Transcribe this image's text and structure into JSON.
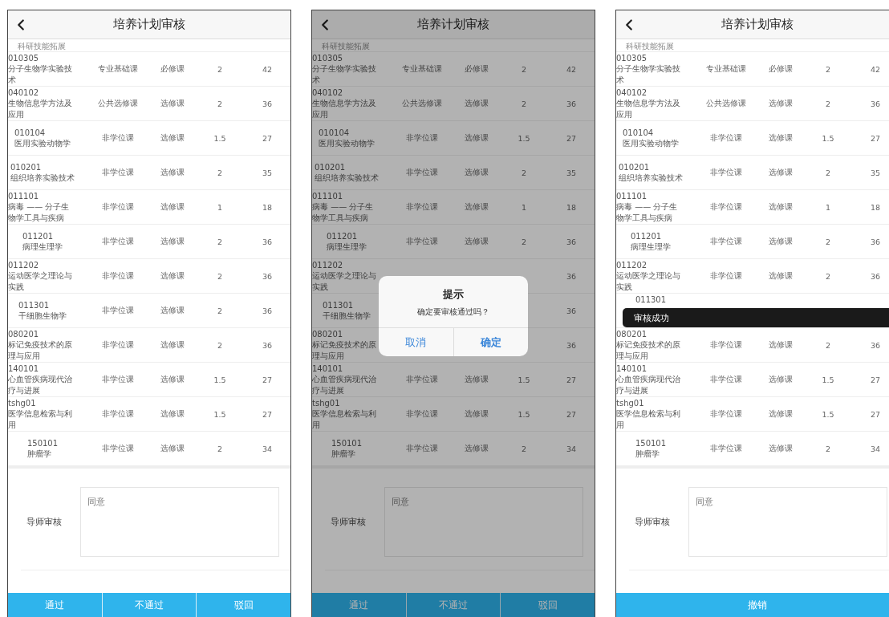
{
  "screens": [
    {
      "title": "培养计划审核",
      "top_note": "科研技能拓展",
      "dimmed": false,
      "rows": [
        {
          "code": "010305",
          "name": "分子生物学实验技术",
          "type": "专业基础课",
          "category": "必修课",
          "credits": "2",
          "hours": "42"
        },
        {
          "code": "040102",
          "name": "生物信息学方法及应用",
          "type": "公共选修课",
          "category": "选修课",
          "credits": "2",
          "hours": "36"
        },
        {
          "code": "010104",
          "name": "医用实验动物学",
          "type": "非学位课",
          "category": "选修课",
          "credits": "1.5",
          "hours": "27"
        },
        {
          "code": "010201",
          "name": "组织培养实验技术",
          "type": "非学位课",
          "category": "选修课",
          "credits": "2",
          "hours": "35"
        },
        {
          "code": "011101",
          "name": "病毒 —— 分子生物学工具与疾病",
          "type": "非学位课",
          "category": "选修课",
          "credits": "1",
          "hours": "18"
        },
        {
          "code": "011201",
          "name": "病理生理学",
          "type": "非学位课",
          "category": "选修课",
          "credits": "2",
          "hours": "36"
        },
        {
          "code": "011202",
          "name": "运动医学之理论与实践",
          "type": "非学位课",
          "category": "选修课",
          "credits": "2",
          "hours": "36"
        },
        {
          "code": "011301",
          "name": "干细胞生物学",
          "type": "非学位课",
          "category": "选修课",
          "credits": "2",
          "hours": "36"
        },
        {
          "code": "080201",
          "name": "标记免疫技术的原理与应用",
          "type": "非学位课",
          "category": "选修课",
          "credits": "2",
          "hours": "36"
        },
        {
          "code": "140101",
          "name": "心血管疾病现代治疗与进展",
          "type": "非学位课",
          "category": "选修课",
          "credits": "1.5",
          "hours": "27"
        },
        {
          "code": "tshg01",
          "name": "医学信息检索与利用",
          "type": "非学位课",
          "category": "选修课",
          "credits": "1.5",
          "hours": "27"
        },
        {
          "code": "150101",
          "name": "肿瘤学",
          "type": "非学位课",
          "category": "选修课",
          "credits": "2",
          "hours": "34"
        }
      ],
      "review": {
        "label": "导师审核",
        "value": "同意"
      },
      "actions": [
        "通过",
        "不通过",
        "驳回"
      ]
    },
    {
      "title": "培养计划审核",
      "top_note": "科研技能拓展",
      "dimmed": true,
      "rows": [
        {
          "code": "010305",
          "name": "分子生物学实验技术",
          "type": "专业基础课",
          "category": "必修课",
          "credits": "2",
          "hours": "42"
        },
        {
          "code": "040102",
          "name": "生物信息学方法及应用",
          "type": "公共选修课",
          "category": "选修课",
          "credits": "2",
          "hours": "36"
        },
        {
          "code": "010104",
          "name": "医用实验动物学",
          "type": "非学位课",
          "category": "选修课",
          "credits": "1.5",
          "hours": "27"
        },
        {
          "code": "010201",
          "name": "组织培养实验技术",
          "type": "非学位课",
          "category": "选修课",
          "credits": "2",
          "hours": "35"
        },
        {
          "code": "011101",
          "name": "病毒 —— 分子生物学工具与疾病",
          "type": "非学位课",
          "category": "选修课",
          "credits": "1",
          "hours": "18"
        },
        {
          "code": "011201",
          "name": "病理生理学",
          "type": "非学位课",
          "category": "选修课",
          "credits": "2",
          "hours": "36"
        },
        {
          "code": "011202",
          "name": "运动医学之理论与实践",
          "hours": "36"
        },
        {
          "code": "011301",
          "name": "干细胞生物学",
          "hours": "36"
        },
        {
          "code": "080201",
          "name": "标记免疫技术的原理与应用",
          "hours": "36"
        },
        {
          "code": "140101",
          "name": "心血管疾病现代治疗与进展",
          "type": "非学位课",
          "category": "选修课",
          "credits": "1.5",
          "hours": "27"
        },
        {
          "code": "tshg01",
          "name": "医学信息检索与利用",
          "type": "非学位课",
          "category": "选修课",
          "credits": "1.5",
          "hours": "27"
        },
        {
          "code": "150101",
          "name": "肿瘤学",
          "type": "非学位课",
          "category": "选修课",
          "credits": "2",
          "hours": "34"
        }
      ],
      "review": {
        "label": "导师审核",
        "value": "同意"
      },
      "actions": [
        "通过",
        "不通过",
        "驳回"
      ],
      "dialog": {
        "title": "提示",
        "message": "确定要审核通过吗？",
        "buttons": [
          {
            "label": "取消",
            "kind": "cancel"
          },
          {
            "label": "确定",
            "kind": "confirm"
          }
        ]
      }
    },
    {
      "title": "培养计划审核",
      "top_note": "科研技能拓展",
      "dimmed": false,
      "rows": [
        {
          "code": "010305",
          "name": "分子生物学实验技术",
          "type": "专业基础课",
          "category": "必修课",
          "credits": "2",
          "hours": "42"
        },
        {
          "code": "040102",
          "name": "生物信息学方法及应用",
          "type": "公共选修课",
          "category": "选修课",
          "credits": "2",
          "hours": "36"
        },
        {
          "code": "010104",
          "name": "医用实验动物学",
          "type": "非学位课",
          "category": "选修课",
          "credits": "1.5",
          "hours": "27"
        },
        {
          "code": "010201",
          "name": "组织培养实验技术",
          "type": "非学位课",
          "category": "选修课",
          "credits": "2",
          "hours": "35"
        },
        {
          "code": "011101",
          "name": "病毒 —— 分子生物学工具与疾病",
          "type": "非学位课",
          "category": "选修课",
          "credits": "1",
          "hours": "18"
        },
        {
          "code": "011201",
          "name": "病理生理学",
          "type": "非学位课",
          "category": "选修课",
          "credits": "2",
          "hours": "36"
        },
        {
          "code": "011202",
          "name": "运动医学之理论与实践",
          "type": "非学位课",
          "category": "选修课",
          "credits": "2",
          "hours": "36"
        },
        {
          "code": "011301"
        },
        {
          "code": "080201",
          "name": "标记免疫技术的原理与应用",
          "type": "非学位课",
          "category": "选修课",
          "credits": "2",
          "hours": "36"
        },
        {
          "code": "140101",
          "name": "心血管疾病现代治疗与进展",
          "type": "非学位课",
          "category": "选修课",
          "credits": "1.5",
          "hours": "27"
        },
        {
          "code": "tshg01",
          "name": "医学信息检索与利用",
          "type": "非学位课",
          "category": "选修课",
          "credits": "1.5",
          "hours": "27"
        },
        {
          "code": "150101",
          "name": "肿瘤学",
          "type": "非学位课",
          "category": "选修课",
          "credits": "2",
          "hours": "34"
        }
      ],
      "review": {
        "label": "导师审核",
        "value": "同意"
      },
      "actions": [
        "撤销"
      ],
      "toast": "审核成功"
    }
  ]
}
